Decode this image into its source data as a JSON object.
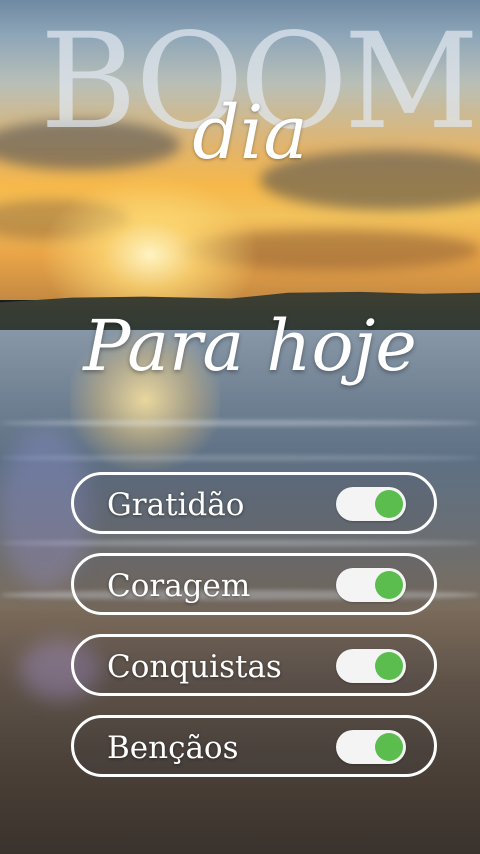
{
  "colors": {
    "toggle_on": "#5bbd4e",
    "toggle_track": "#f4f4f4",
    "text": "#ffffff"
  },
  "header": {
    "title_big": "BOOM",
    "title_script": "dia"
  },
  "subtitle": "Para hoje",
  "toggles": [
    {
      "label": "Gratidão",
      "on": true
    },
    {
      "label": "Coragem",
      "on": true
    },
    {
      "label": "Conquistas",
      "on": true
    },
    {
      "label": "Bençãos",
      "on": true
    }
  ]
}
